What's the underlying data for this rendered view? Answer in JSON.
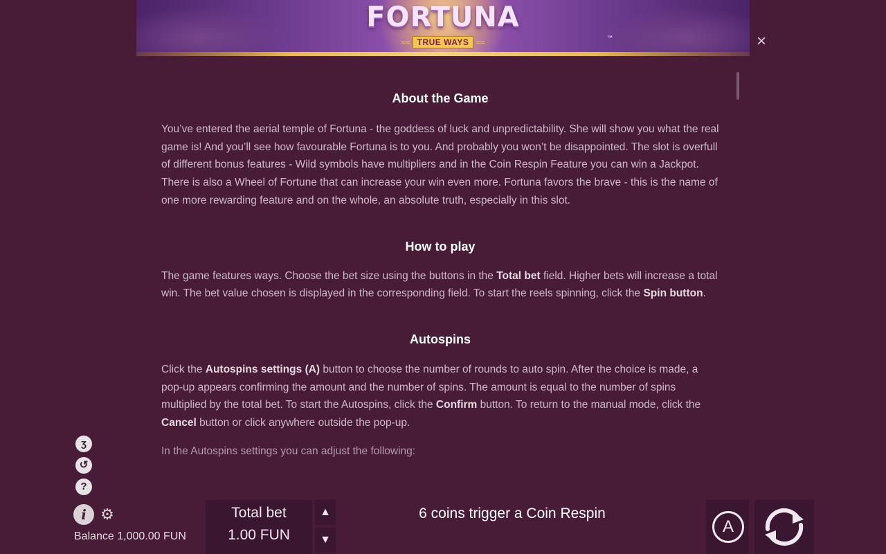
{
  "header": {
    "logo_text": "FORTUNA",
    "logo_subtitle": "TRUE WAYS",
    "logo_tm": "™",
    "close_glyph": "×"
  },
  "content": {
    "about_title": "About the Game",
    "about_text": "You’ve entered the aerial temple of Fortuna - the goddess of luck and unpredictability. She will show you what the real game is! And you’ll see how favourable Fortuna is to you. And probably you won’t be disappointed. The slot is overfull of different bonus features - Wild symbols have multipliers and in the Coin Respin Feature you can win a Jackpot. There is also a Wheel of Fortune that can increase your win even more. Fortuna favors the brave - this is the name of one more rewarding feature and on the whole, an absolute truth, especially in this slot.",
    "how_title": "How to play",
    "how_text_1": "The game features ways. Choose the bet size using the buttons in the ",
    "how_bold_1": "Total bet",
    "how_text_2": " field. Higher bets will increase a total win. The bet value chosen is displayed in the corresponding field. To start the reels spinning, click the ",
    "how_bold_2": "Spin button",
    "how_text_3": ".",
    "auto_title": "Autospins",
    "auto_text_1": "Click the ",
    "auto_bold_1": "Autospins settings (A)",
    "auto_text_2": " button to choose the number of rounds to auto spin. After the choice is made, a pop-up appears confirming the amount and the number of spins. The amount is equal to the number of spins multiplied by the total bet. To start the Autospins, click the ",
    "auto_bold_2": "Confirm",
    "auto_text_3": " button. To return to the manual mode, click the ",
    "auto_bold_3": "Cancel",
    "auto_text_4": " button or click anywhere outside the pop-up.",
    "adjust_text": "In the Autospins settings you can adjust the following:"
  },
  "sidebar": {
    "turbo_glyph": "ʒ",
    "history_glyph": "↺",
    "help_glyph": "?",
    "info_glyph": "i",
    "settings_glyph": "⚙"
  },
  "footer": {
    "balance_label": "Balance",
    "balance_value": "1,000.00 FUN",
    "bet_label": "Total bet",
    "bet_value": "1.00 FUN",
    "bet_up_glyph": "▲",
    "bet_down_glyph": "▼",
    "message": "6 coins trigger a Coin Respin",
    "autospin_glyph": "A"
  },
  "colors": {
    "background": "#481c37",
    "panel": "#3a1630",
    "heading": "#ffffff",
    "body_text": "#cdb9c5"
  },
  "icons": [
    "close-icon",
    "turbo-icon",
    "history-icon",
    "help-icon",
    "info-icon",
    "gear-icon",
    "arrow-up-icon",
    "arrow-down-icon",
    "autospin-icon",
    "spin-icon"
  ]
}
